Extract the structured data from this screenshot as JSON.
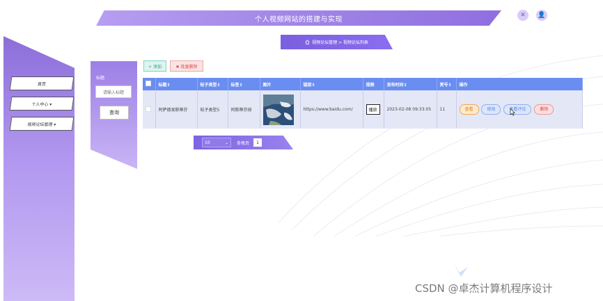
{
  "header": {
    "title": "个人视频网站的搭建与实现"
  },
  "top_icons": [
    {
      "name": "fullscreen-icon",
      "glyph": "✕"
    },
    {
      "name": "user-icon",
      "glyph": "👤"
    }
  ],
  "sidebar": {
    "items": [
      {
        "label": "首页"
      },
      {
        "label": "个人中心 ▾"
      },
      {
        "label": "视频论坛管理 ▾"
      }
    ]
  },
  "search": {
    "label": "标题",
    "placeholder": "请输入标题",
    "button": "查询"
  },
  "breadcrumb": {
    "home_icon": "home-icon",
    "path": "视频论坛管理 > 视频论坛列表"
  },
  "actions": {
    "add": "+ 添加",
    "batch_delete": "✖ 批量删除"
  },
  "table": {
    "headers": [
      "",
      "标题⇕",
      "帖子类型⇕",
      "标签⇕",
      "图片",
      "链接⇕",
      "视频",
      "发布时间⇕",
      "赏号⇕",
      "操作"
    ],
    "rows": [
      {
        "title": "阿萨德发斯蒂芬",
        "type": "帖子类型5",
        "tag": "阿斯蒂芬按",
        "link": "https://www.baidu.com/",
        "video": "播放",
        "time": "2023-02-08 09:33:05",
        "num": "11",
        "ops": [
          "查看",
          "修改",
          "查看评论",
          "删除"
        ]
      }
    ]
  },
  "pager": {
    "page_size": "10",
    "label": "条每页",
    "page": "1"
  },
  "watermark": "CSDN @卓杰计算机程序设计"
}
